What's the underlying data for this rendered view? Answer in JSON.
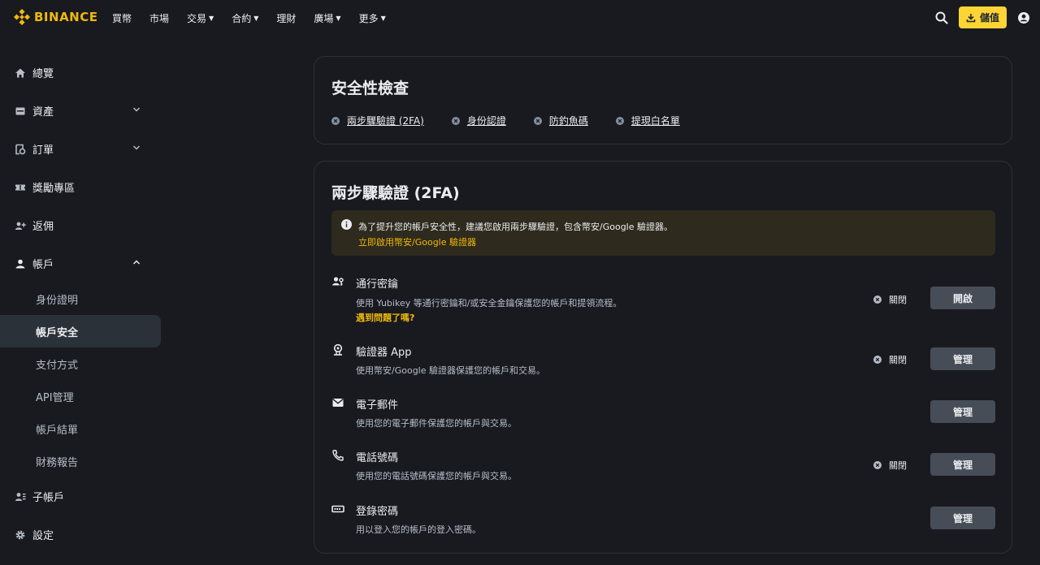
{
  "colors": {
    "accent": "#f0b90b",
    "background": "#181a20",
    "button": "#474d57"
  },
  "header": {
    "logo_text": "BINANCE",
    "nav": [
      {
        "label": "買幣",
        "dropdown": false
      },
      {
        "label": "市場",
        "dropdown": false
      },
      {
        "label": "交易",
        "dropdown": true
      },
      {
        "label": "合約",
        "dropdown": true
      },
      {
        "label": "理財",
        "dropdown": false
      },
      {
        "label": "廣場",
        "dropdown": true
      },
      {
        "label": "更多",
        "dropdown": true
      }
    ],
    "deposit_label": "儲值",
    "icons": [
      "search-icon",
      "download-icon",
      "user-icon"
    ]
  },
  "sidebar": {
    "items": [
      {
        "label": "總覽",
        "icon": "home-icon"
      },
      {
        "label": "資產",
        "icon": "wallet-icon"
      },
      {
        "label": "訂單",
        "icon": "orders-icon"
      },
      {
        "label": "獎勵專區",
        "icon": "ticket-icon"
      },
      {
        "label": "返佣",
        "icon": "user-plus-icon"
      },
      {
        "label": "帳戶",
        "icon": "user-icon"
      },
      {
        "label": "子帳戶",
        "icon": "sub-account-icon"
      },
      {
        "label": "設定",
        "icon": "gear-icon"
      }
    ],
    "account_sub": [
      "身份證明",
      "帳戶安全",
      "支付方式",
      "API管理",
      "帳戶結單",
      "財務報告"
    ],
    "active_sub": "帳戶安全"
  },
  "security_check": {
    "title": "安全性檢查",
    "items": [
      "兩步驟驗證 (2FA)",
      "身份認證",
      "防釣魚碼",
      "提現白名單"
    ]
  },
  "twofa": {
    "title": "兩步驟驗證 (2FA)",
    "notice_text": "為了提升您的帳戶安全性，建議您啟用兩步驟驗證，包含幣安/Google 驗證器。",
    "notice_link": "立即啟用幣安/Google 驗證器",
    "rows": [
      {
        "title": "通行密鑰",
        "desc": "使用 Yubikey 等通行密鑰和/或安全金鑰保護您的帳戶和提領流程。",
        "link": "遇到問題了嗎?",
        "status": "關閉",
        "button": "開啟",
        "icon": "passkey-icon"
      },
      {
        "title": "驗證器 App",
        "desc": "使用幣安/Google 驗證器保護您的帳戶和交易。",
        "status": "關閉",
        "button": "管理",
        "icon": "authenticator-icon"
      },
      {
        "title": "電子郵件",
        "desc": "使用您的電子郵件保護您的帳戶與交易。",
        "button": "管理",
        "icon": "email-icon"
      },
      {
        "title": "電話號碼",
        "desc": "使用您的電話號碼保護您的帳戶與交易。",
        "status": "關閉",
        "button": "管理",
        "icon": "phone-icon"
      },
      {
        "title": "登錄密碼",
        "desc": "用以登入您的帳戶的登入密碼。",
        "button": "管理",
        "icon": "password-icon"
      }
    ]
  }
}
